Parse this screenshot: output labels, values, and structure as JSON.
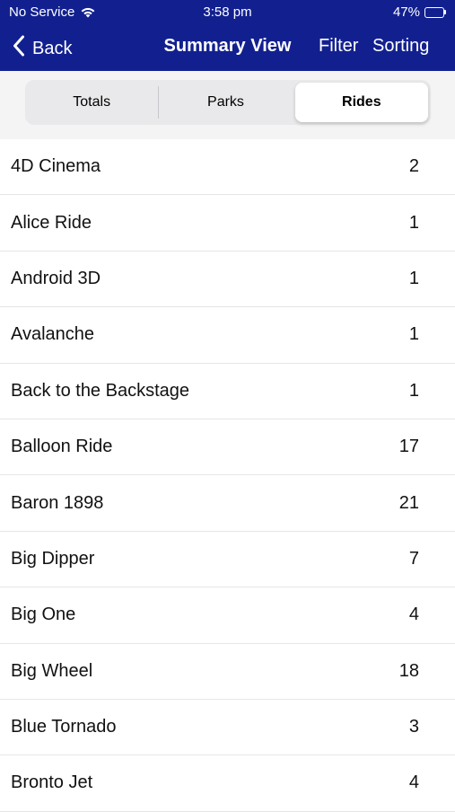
{
  "status_bar": {
    "carrier": "No Service",
    "time": "3:58 pm",
    "battery_percent": "47%",
    "battery_level": 0.47,
    "battery_color": "#4cd964"
  },
  "nav": {
    "back_label": "Back",
    "title": "Summary View",
    "filter_label": "Filter",
    "sorting_label": "Sorting",
    "background_color": "#12208f"
  },
  "segments": [
    {
      "label": "Totals",
      "selected": false
    },
    {
      "label": "Parks",
      "selected": false
    },
    {
      "label": "Rides",
      "selected": true
    }
  ],
  "rides": [
    {
      "name": "4D Cinema",
      "count": "2"
    },
    {
      "name": "Alice Ride",
      "count": "1"
    },
    {
      "name": "Android 3D",
      "count": "1"
    },
    {
      "name": "Avalanche",
      "count": "1"
    },
    {
      "name": "Back to the Backstage",
      "count": "1"
    },
    {
      "name": "Balloon Ride",
      "count": "17"
    },
    {
      "name": "Baron 1898",
      "count": "21"
    },
    {
      "name": "Big Dipper",
      "count": "7"
    },
    {
      "name": "Big One",
      "count": "4"
    },
    {
      "name": "Big Wheel",
      "count": "18"
    },
    {
      "name": "Blue Tornado",
      "count": "3"
    },
    {
      "name": "Bronto Jet",
      "count": "4"
    }
  ]
}
